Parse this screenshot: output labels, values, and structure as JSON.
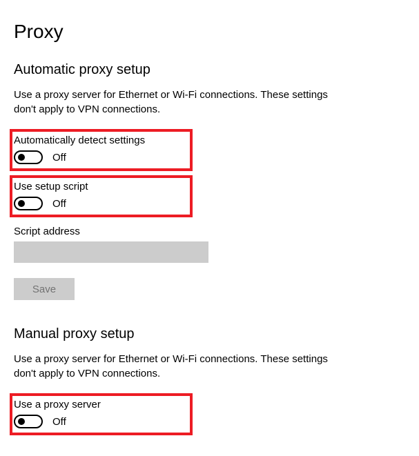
{
  "page_title": "Proxy",
  "automatic": {
    "title": "Automatic proxy setup",
    "description": "Use a proxy server for Ethernet or Wi-Fi connections. These settings don't apply to VPN connections.",
    "auto_detect_label": "Automatically detect settings",
    "auto_detect_state": "Off",
    "use_script_label": "Use setup script",
    "use_script_state": "Off",
    "script_address_label": "Script address",
    "script_address_value": "",
    "save_label": "Save"
  },
  "manual": {
    "title": "Manual proxy setup",
    "description": "Use a proxy server for Ethernet or Wi-Fi connections. These settings don't apply to VPN connections.",
    "use_proxy_label": "Use a proxy server",
    "use_proxy_state": "Off"
  }
}
